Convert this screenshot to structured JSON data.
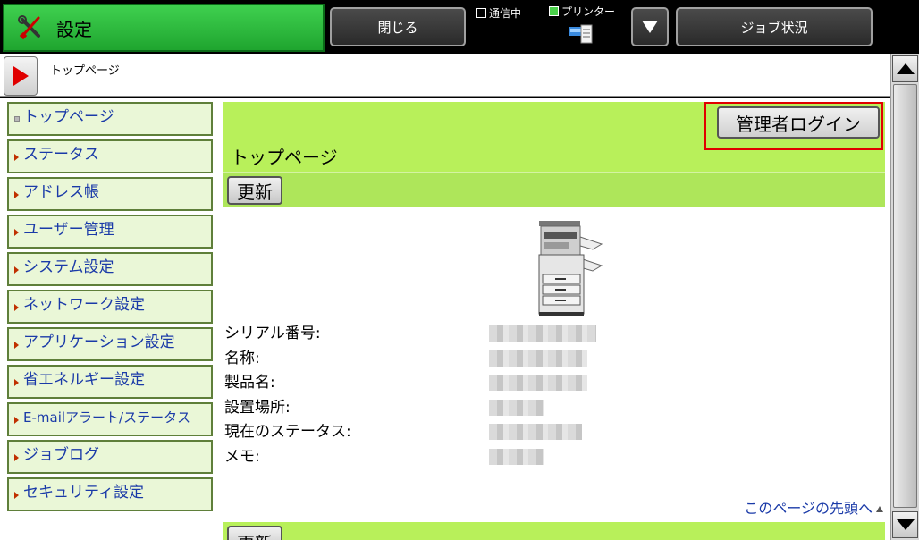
{
  "header": {
    "title": "設定",
    "title_icon": "tools-icon",
    "close_label": "閉じる",
    "status_comm_label": "通信中",
    "status_printer_label": "プリンター",
    "job_status_label": "ジョブ状況",
    "accent_color": "#2fbf3f"
  },
  "breadcrumb": {
    "text": "トップページ"
  },
  "sidebar": {
    "items": [
      {
        "label": "トップページ"
      },
      {
        "label": "ステータス"
      },
      {
        "label": "アドレス帳"
      },
      {
        "label": "ユーザー管理"
      },
      {
        "label": "システム設定"
      },
      {
        "label": "ネットワーク設定"
      },
      {
        "label": "アプリケーション設定"
      },
      {
        "label": "省エネルギー設定"
      },
      {
        "label": "E-mailアラート/ステータス"
      },
      {
        "label": "ジョブログ"
      },
      {
        "label": "セキュリティ設定"
      }
    ]
  },
  "main": {
    "admin_login_label": "管理者ログイン",
    "page_heading": "トップページ",
    "refresh_label": "更新",
    "info": {
      "serial_label": "シリアル番号:",
      "name_label": "名称:",
      "product_label": "製品名:",
      "location_label": "設置場所:",
      "status_label": "現在のステータス:",
      "memo_label": "メモ:"
    },
    "page_top_link": "このページの先頭へ",
    "green_color": "#b8f05a"
  }
}
